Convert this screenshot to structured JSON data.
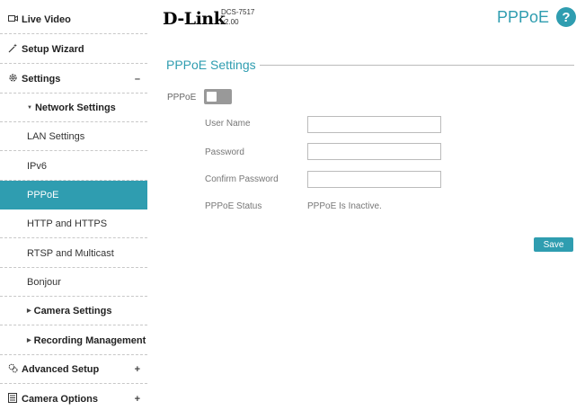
{
  "sidebar": {
    "live_video": "Live Video",
    "setup_wizard": "Setup Wizard",
    "settings": "Settings",
    "settings_toggle": "–",
    "network_settings": "Network Settings",
    "lan_settings": "LAN Settings",
    "ipv6": "IPv6",
    "pppoe": "PPPoE",
    "http_https": "HTTP and HTTPS",
    "rtsp_multicast": "RTSP and Multicast",
    "bonjour": "Bonjour",
    "camera_settings": "Camera Settings",
    "recording_management": "Recording Management",
    "advanced_setup": "Advanced Setup",
    "advanced_toggle": "+",
    "camera_options": "Camera Options",
    "camera_options_toggle": "+"
  },
  "header": {
    "logo": "D-Link",
    "model": "DCS-7517",
    "version": "v2.00",
    "page_title": "PPPoE",
    "help": "?"
  },
  "main": {
    "section_title": "PPPoE Settings",
    "pppoe_label": "PPPoE",
    "pppoe_enabled": false,
    "user_name_label": "User Name",
    "user_name_value": "",
    "password_label": "Password",
    "password_value": "",
    "confirm_password_label": "Confirm Password",
    "confirm_password_value": "",
    "status_label": "PPPoE Status",
    "status_value": "PPPoE Is Inactive.",
    "save_label": "Save"
  },
  "colors": {
    "accent": "#2f9db0",
    "toggle_off": "#999999"
  },
  "icons": {
    "live_video": "video-icon",
    "setup_wizard": "wand-icon",
    "settings": "gear-icon",
    "advanced_setup": "advanced-gear-icon",
    "camera_options": "list-icon"
  }
}
